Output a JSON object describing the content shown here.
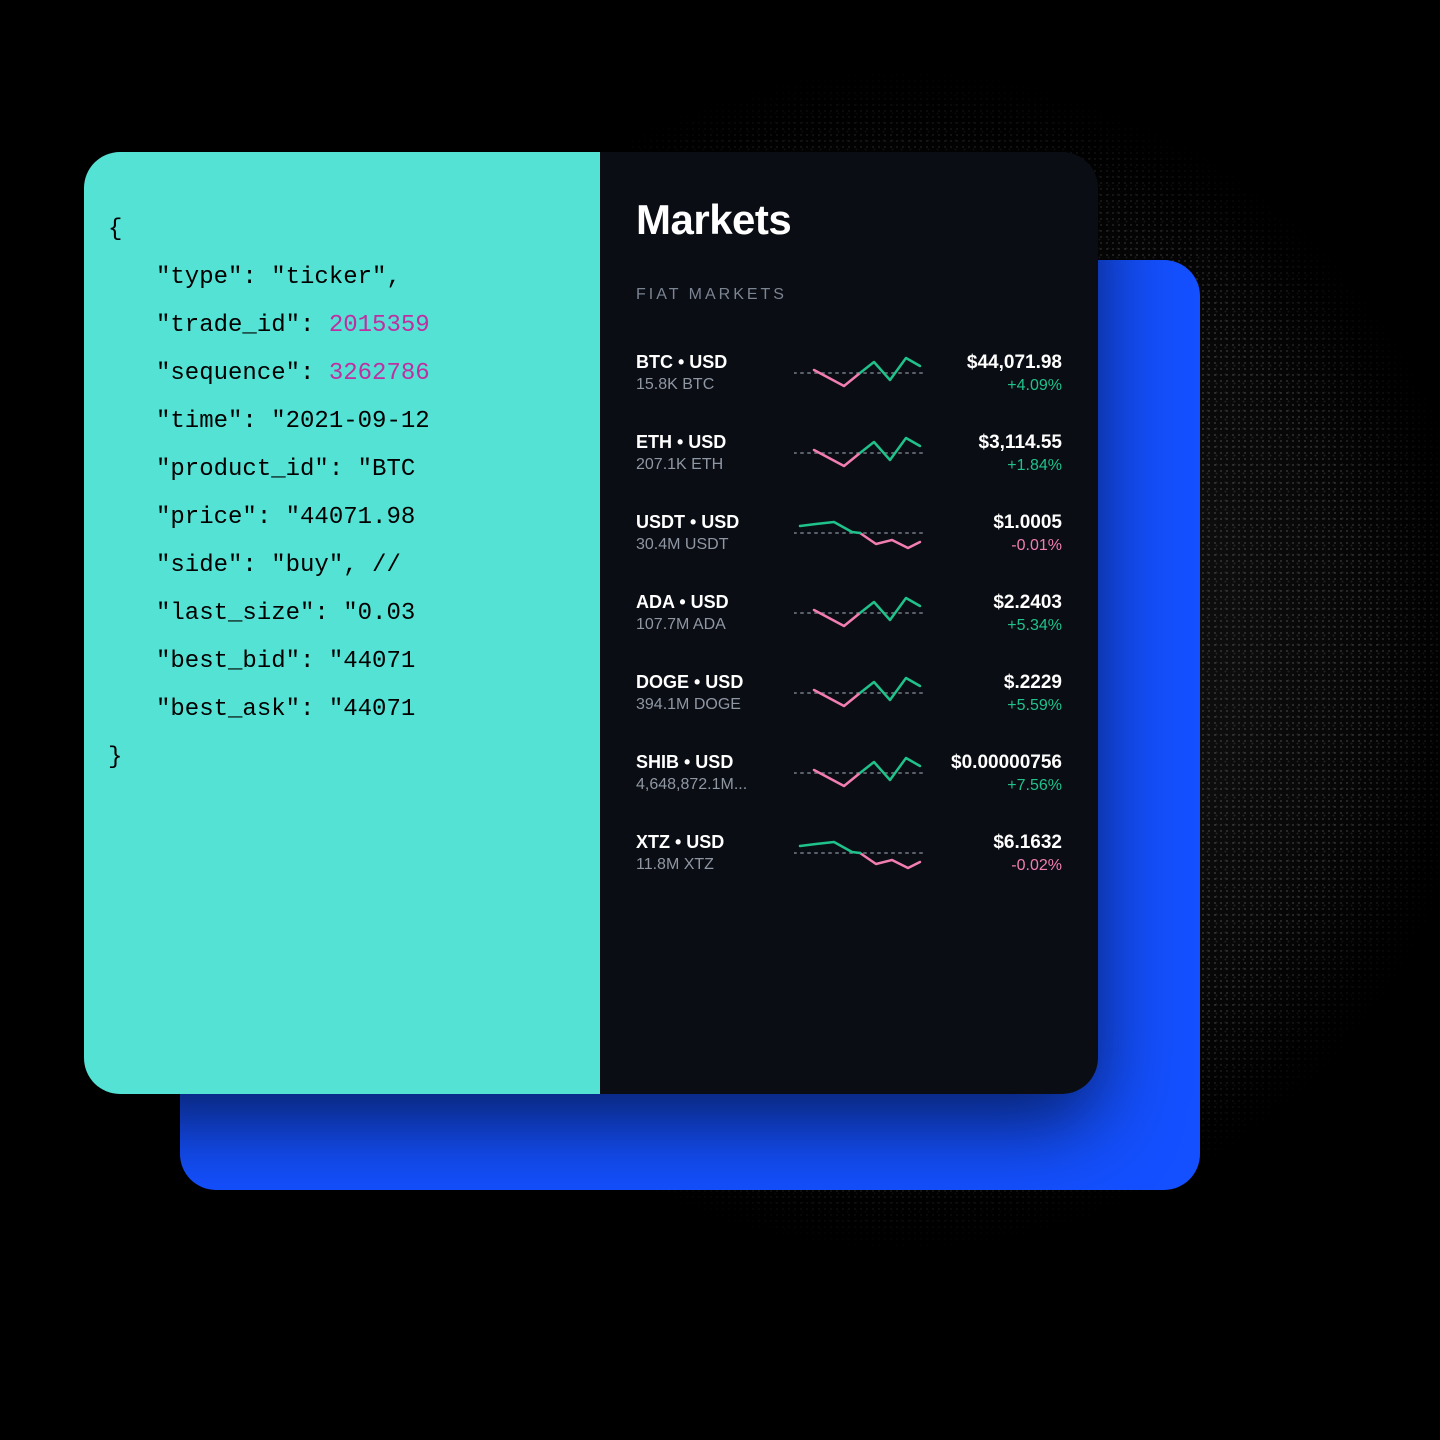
{
  "code": {
    "lines": [
      {
        "indent": 0,
        "parts": [
          {
            "t": "{",
            "k": "plain"
          }
        ]
      },
      {
        "indent": 1,
        "parts": [
          {
            "t": "\"type\": \"ticker\",",
            "k": "plain"
          }
        ]
      },
      {
        "indent": 1,
        "parts": [
          {
            "t": "\"trade_id\": ",
            "k": "plain"
          },
          {
            "t": "2015359",
            "k": "num"
          }
        ]
      },
      {
        "indent": 1,
        "parts": [
          {
            "t": "\"sequence\": ",
            "k": "plain"
          },
          {
            "t": "3262786",
            "k": "num"
          }
        ]
      },
      {
        "indent": 1,
        "parts": [
          {
            "t": "\"time\": \"2021-09-12",
            "k": "plain"
          }
        ]
      },
      {
        "indent": 1,
        "parts": [
          {
            "t": "\"product_id\": \"BTC",
            "k": "plain"
          }
        ]
      },
      {
        "indent": 1,
        "parts": [
          {
            "t": "\"price\": \"44071.98",
            "k": "plain"
          }
        ]
      },
      {
        "indent": 1,
        "parts": [
          {
            "t": "\"side\": \"buy\", // ",
            "k": "plain"
          }
        ]
      },
      {
        "indent": 1,
        "parts": [
          {
            "t": "\"last_size\": \"0.03",
            "k": "plain"
          }
        ]
      },
      {
        "indent": 1,
        "parts": [
          {
            "t": "\"best_bid\": \"44071",
            "k": "plain"
          }
        ]
      },
      {
        "indent": 1,
        "parts": [
          {
            "t": "\"best_ask\": \"44071",
            "k": "plain"
          }
        ]
      },
      {
        "indent": 0,
        "parts": [
          {
            "t": "}",
            "k": "plain"
          }
        ]
      }
    ]
  },
  "markets": {
    "title": "Markets",
    "section": "FIAT MARKETS",
    "rows": [
      {
        "pair": "BTC • USD",
        "sub": "15.8K BTC",
        "price": "$44,071.98",
        "change": "+4.09%",
        "dir": "pos",
        "spark": "A"
      },
      {
        "pair": "ETH • USD",
        "sub": "207.1K ETH",
        "price": "$3,114.55",
        "change": "+1.84%",
        "dir": "pos",
        "spark": "A"
      },
      {
        "pair": "USDT • USD",
        "sub": "30.4M USDT",
        "price": "$1.0005",
        "change": "-0.01%",
        "dir": "neg",
        "spark": "B"
      },
      {
        "pair": "ADA • USD",
        "sub": "107.7M ADA",
        "price": "$2.2403",
        "change": "+5.34%",
        "dir": "pos",
        "spark": "A"
      },
      {
        "pair": "DOGE • USD",
        "sub": "394.1M DOGE",
        "price": "$.2229",
        "change": "+5.59%",
        "dir": "pos",
        "spark": "A"
      },
      {
        "pair": "SHIB • USD",
        "sub": "4,648,872.1M...",
        "price": "$0.00000756",
        "change": "+7.56%",
        "dir": "pos",
        "spark": "A"
      },
      {
        "pair": "XTZ • USD",
        "sub": "11.8M XTZ",
        "price": "$6.1632",
        "change": "-0.02%",
        "dir": "neg",
        "spark": "B"
      }
    ]
  },
  "colors": {
    "green": "#1fc28b",
    "pink": "#f27eb1",
    "midline": "#5a616c"
  }
}
